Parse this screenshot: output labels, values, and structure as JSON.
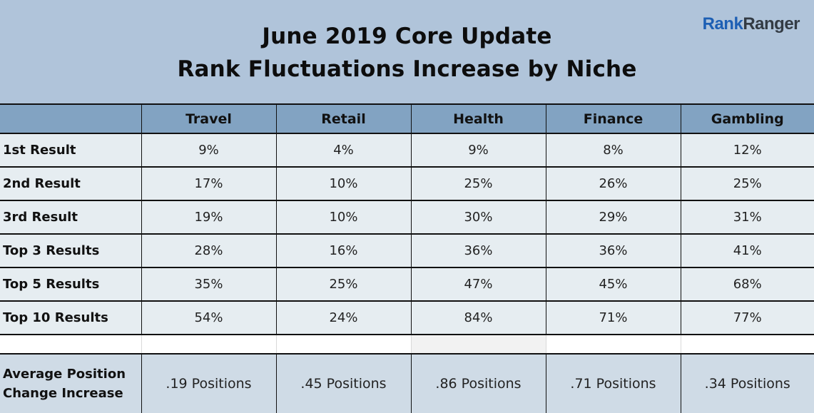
{
  "header": {
    "title_line1": "June 2019 Core Update",
    "title_line2": "Rank Fluctuations Increase by Niche",
    "logo_part1": "Rank",
    "logo_part2": "Ranger"
  },
  "colors": {
    "background": "#b0c4da",
    "header_row": "#82a3c2",
    "data_row": "#e6edf1",
    "summary_row": "#cfdbe6",
    "logo_blue": "#1d5fb4",
    "logo_dark": "#333b44"
  },
  "chart_data": {
    "type": "table",
    "title": "June 2019 Core Update — Rank Fluctuations Increase by Niche",
    "columns": [
      "",
      "Travel",
      "Retail",
      "Health",
      "Finance",
      "Gambling"
    ],
    "rows": [
      {
        "label": "1st Result",
        "values": [
          "9%",
          "4%",
          "9%",
          "8%",
          "12%"
        ]
      },
      {
        "label": "2nd Result",
        "values": [
          "17%",
          "10%",
          "25%",
          "26%",
          "25%"
        ]
      },
      {
        "label": "3rd Result",
        "values": [
          "19%",
          "10%",
          "30%",
          "29%",
          "31%"
        ]
      },
      {
        "label": "Top 3 Results",
        "values": [
          "28%",
          "16%",
          "36%",
          "36%",
          "41%"
        ]
      },
      {
        "label": "Top 5 Results",
        "values": [
          "35%",
          "25%",
          "47%",
          "45%",
          "68%"
        ]
      },
      {
        "label": "Top 10 Results",
        "values": [
          "54%",
          "24%",
          "84%",
          "71%",
          "77%"
        ]
      }
    ],
    "summary": {
      "label_line1": "Average Position",
      "label_line2": "Change Increase",
      "values": [
        ".19 Positions",
        ".45 Positions",
        ".86 Positions",
        ".71 Positions",
        ".34 Positions"
      ]
    }
  }
}
